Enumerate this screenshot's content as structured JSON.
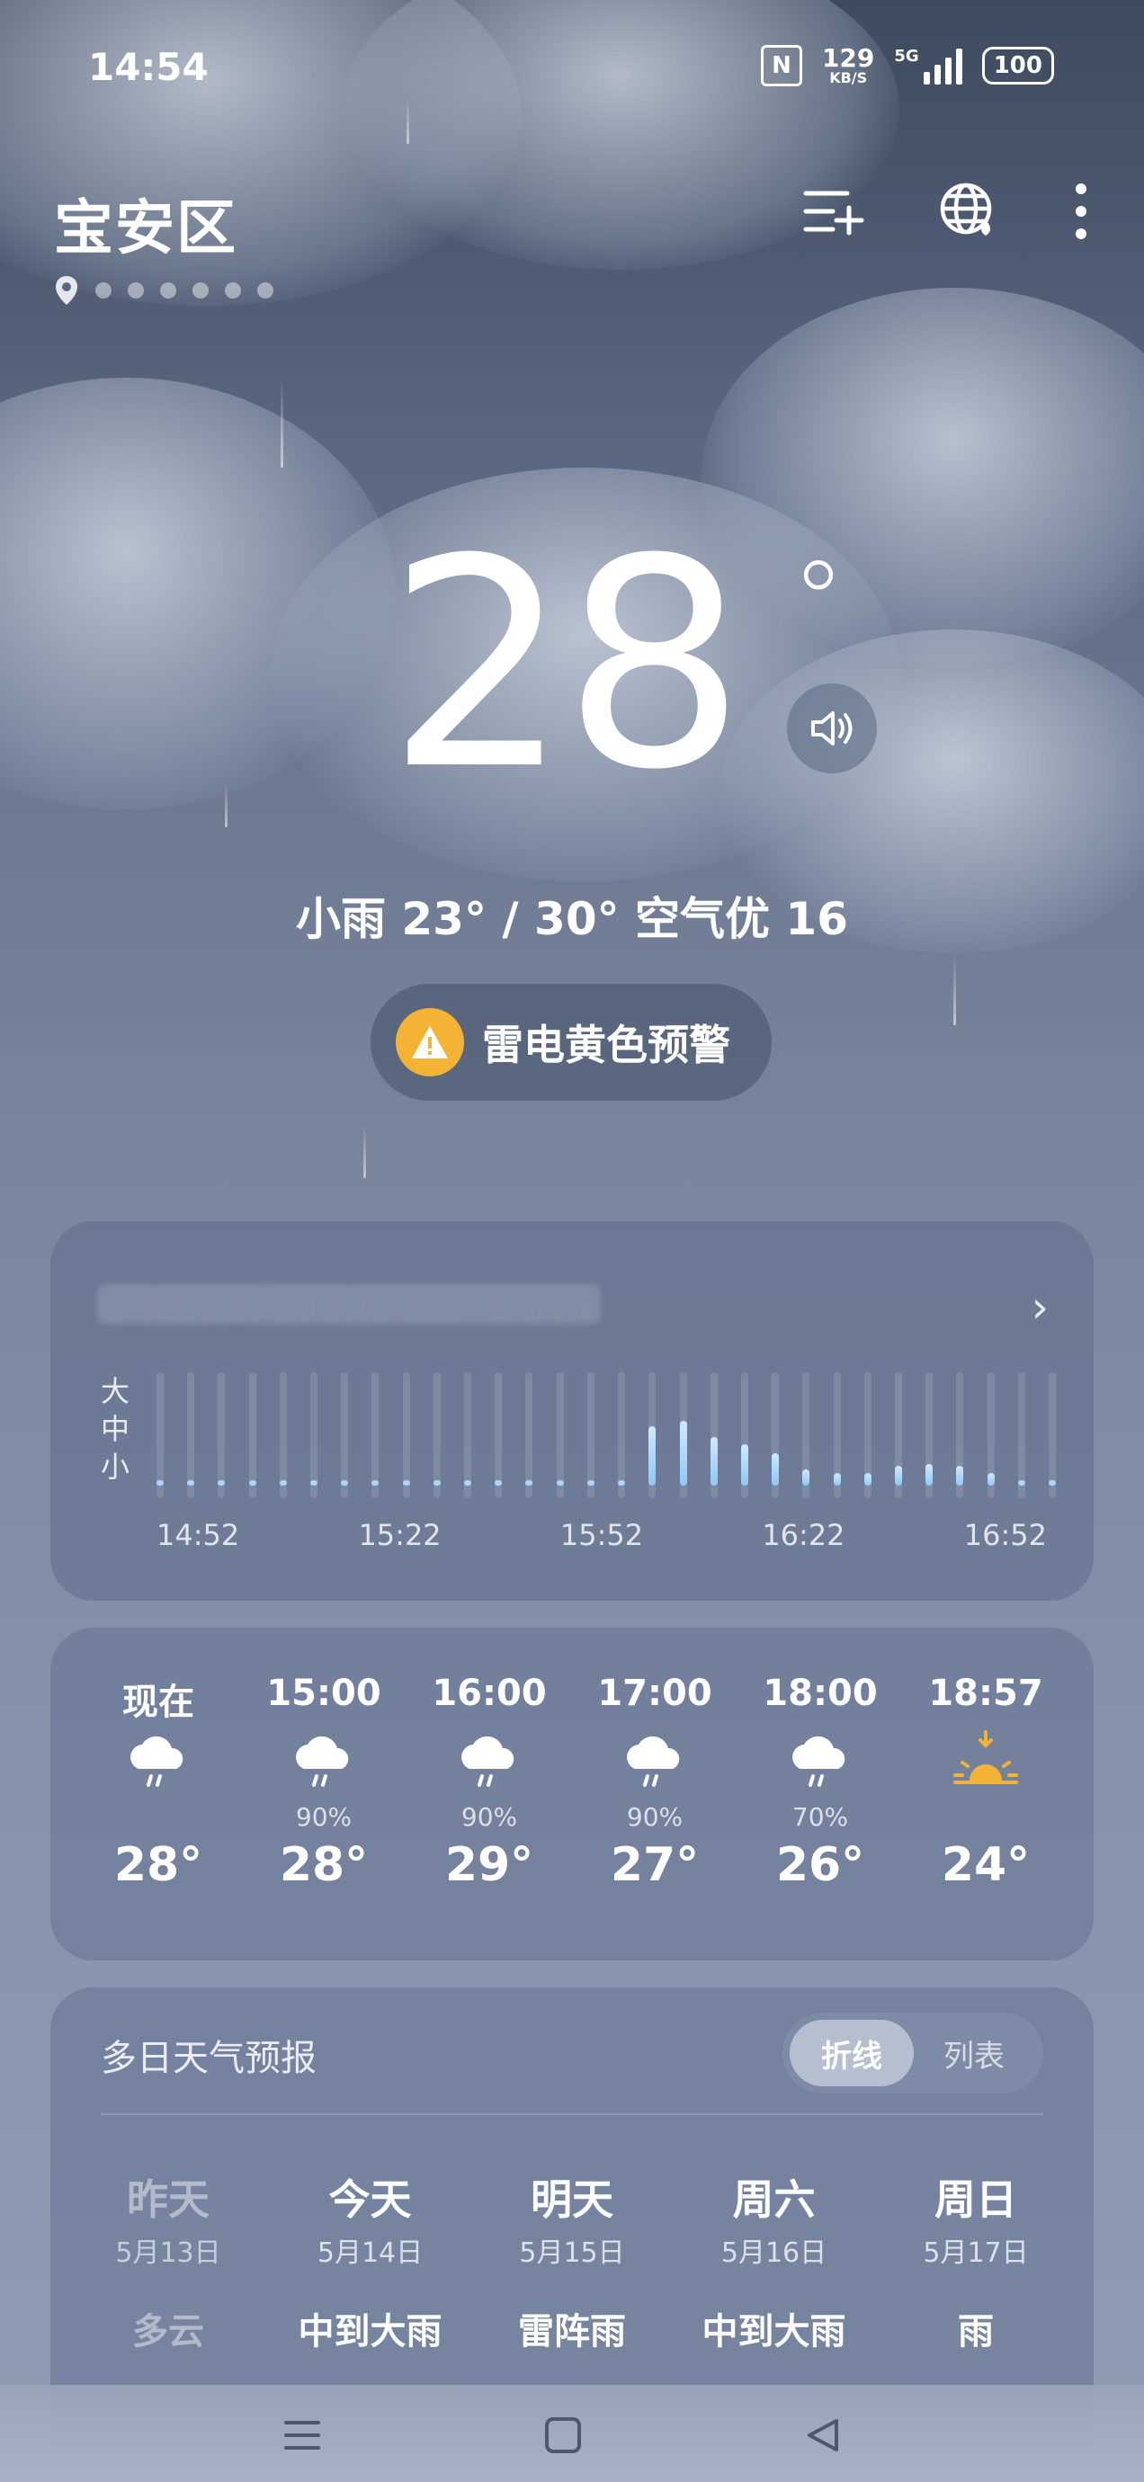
{
  "status_bar": {
    "time": "14:54",
    "nfc": "N",
    "net_speed": "129",
    "net_unit": "KB/S",
    "network": "5G",
    "battery": "100"
  },
  "header": {
    "location": "宝安区",
    "icons": [
      "add-city-icon",
      "globe-icon",
      "more-icon"
    ]
  },
  "current": {
    "temperature": "28",
    "degree": "°",
    "summary": "小雨  23° / 30°  空气优 16",
    "alert": "雷电黄色预警"
  },
  "precip_card": {
    "levels": [
      "大",
      "中",
      "小"
    ],
    "times": [
      "14:52",
      "15:22",
      "15:52",
      "16:22",
      "16:52"
    ],
    "intensity": [
      0.05,
      0.05,
      0.05,
      0.08,
      0.05,
      0.08,
      0.05,
      0.05,
      0.05,
      0.05,
      0.05,
      0.05,
      0.05,
      0.05,
      0.08,
      0.05,
      0.55,
      0.6,
      0.45,
      0.38,
      0.3,
      0.15,
      0.12,
      0.12,
      0.18,
      0.2,
      0.18,
      0.12,
      0.05,
      0.05
    ]
  },
  "hourly": [
    {
      "time": "现在",
      "icon": "rain-icon",
      "precip": "",
      "temp": "28°"
    },
    {
      "time": "15:00",
      "icon": "rain-icon",
      "precip": "90%",
      "temp": "28°"
    },
    {
      "time": "16:00",
      "icon": "rain-icon",
      "precip": "90%",
      "temp": "29°"
    },
    {
      "time": "17:00",
      "icon": "rain-icon",
      "precip": "90%",
      "temp": "27°"
    },
    {
      "time": "18:00",
      "icon": "rain-icon",
      "precip": "70%",
      "temp": "26°"
    },
    {
      "time": "18:57",
      "icon": "sunset-icon",
      "precip": "",
      "temp": "24°"
    }
  ],
  "forecast": {
    "title": "多日天气预报",
    "toggle_on": "折线",
    "toggle_off": "列表",
    "days": [
      {
        "name": "昨天",
        "date": "5月13日",
        "weather": "多云"
      },
      {
        "name": "今天",
        "date": "5月14日",
        "weather": "中到大雨"
      },
      {
        "name": "明天",
        "date": "5月15日",
        "weather": "雷阵雨"
      },
      {
        "name": "周六",
        "date": "5月16日",
        "weather": "中到大雨"
      },
      {
        "name": "周日",
        "date": "5月17日",
        "weather": "雨"
      }
    ]
  },
  "colors": {
    "alert_yellow": "#f5b335",
    "rain_bar": "#a9d6fa"
  }
}
